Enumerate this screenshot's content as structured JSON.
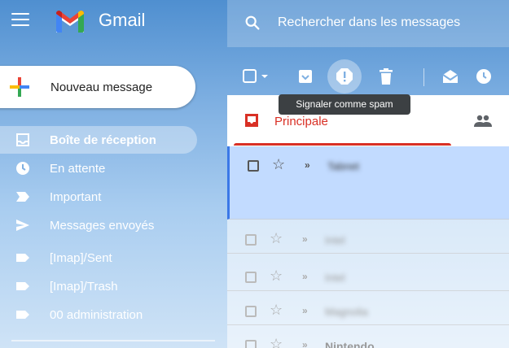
{
  "app": {
    "name": "Gmail"
  },
  "search": {
    "placeholder": "Rechercher dans les messages"
  },
  "compose": {
    "label": "Nouveau message"
  },
  "sidebar": {
    "items": [
      {
        "label": "Boîte de réception",
        "icon": "inbox-icon",
        "active": true
      },
      {
        "label": "En attente",
        "icon": "clock-icon"
      },
      {
        "label": "Important",
        "icon": "important-icon"
      },
      {
        "label": "Messages envoyés",
        "icon": "send-icon"
      },
      {
        "label": "[Imap]/Sent",
        "icon": "label-icon"
      },
      {
        "label": "[Imap]/Trash",
        "icon": "label-icon"
      },
      {
        "label": "00 administration",
        "icon": "label-icon"
      }
    ]
  },
  "toolbar": {
    "tooltip": "Signaler comme spam"
  },
  "tabs": {
    "primary": "Principale"
  },
  "messages": [
    {
      "sender": "Tabnet"
    },
    {
      "sender": "Intel"
    },
    {
      "sender": "Intel"
    },
    {
      "sender": "Magnolia"
    },
    {
      "sender": "Nintendo"
    }
  ],
  "colors": {
    "accent_red": "#d93025",
    "selected_row": "#c2dbff",
    "selected_border": "#3b78e7"
  }
}
